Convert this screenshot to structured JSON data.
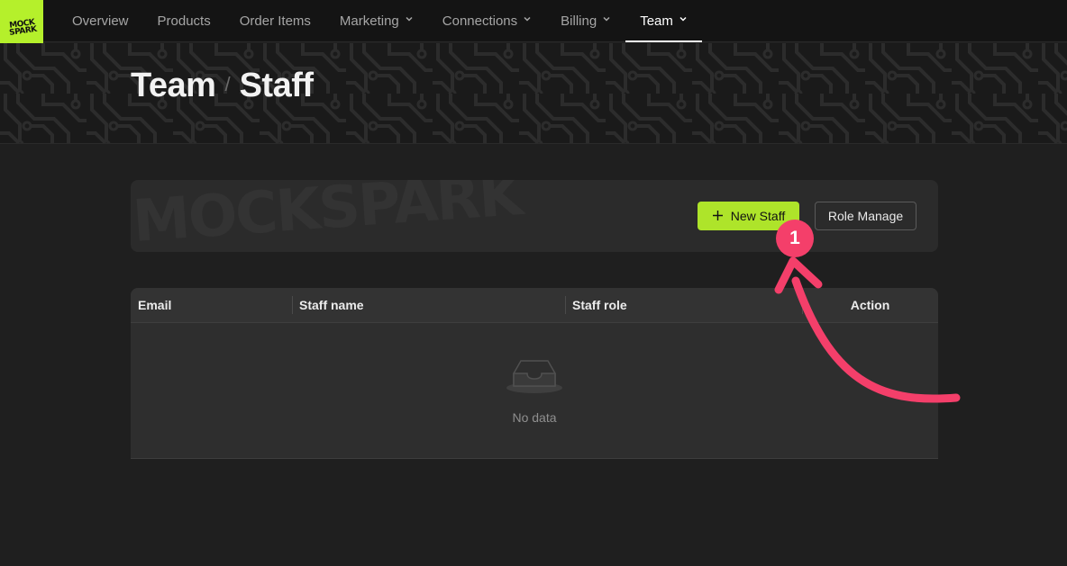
{
  "brand": {
    "logo_line1": "MOCK",
    "logo_line2": "SPARK",
    "accent": "#aee42a"
  },
  "nav": {
    "items": [
      {
        "label": "Overview",
        "dropdown": false,
        "active": false
      },
      {
        "label": "Products",
        "dropdown": false,
        "active": false
      },
      {
        "label": "Order Items",
        "dropdown": false,
        "active": false
      },
      {
        "label": "Marketing",
        "dropdown": true,
        "active": false
      },
      {
        "label": "Connections",
        "dropdown": true,
        "active": false
      },
      {
        "label": "Billing",
        "dropdown": true,
        "active": false
      },
      {
        "label": "Team",
        "dropdown": true,
        "active": true
      }
    ]
  },
  "breadcrumb": {
    "parent": "Team",
    "separator": "/",
    "current": "Staff"
  },
  "toolbar": {
    "watermark": "MOCKSPARK",
    "new_staff_label": "New Staff",
    "role_manage_label": "Role Manage"
  },
  "table": {
    "columns": [
      "Email",
      "Staff name",
      "Staff role",
      "Action"
    ],
    "rows": [],
    "empty_text": "No data"
  },
  "annotation": {
    "step_number": "1",
    "color": "#f43f6a"
  }
}
